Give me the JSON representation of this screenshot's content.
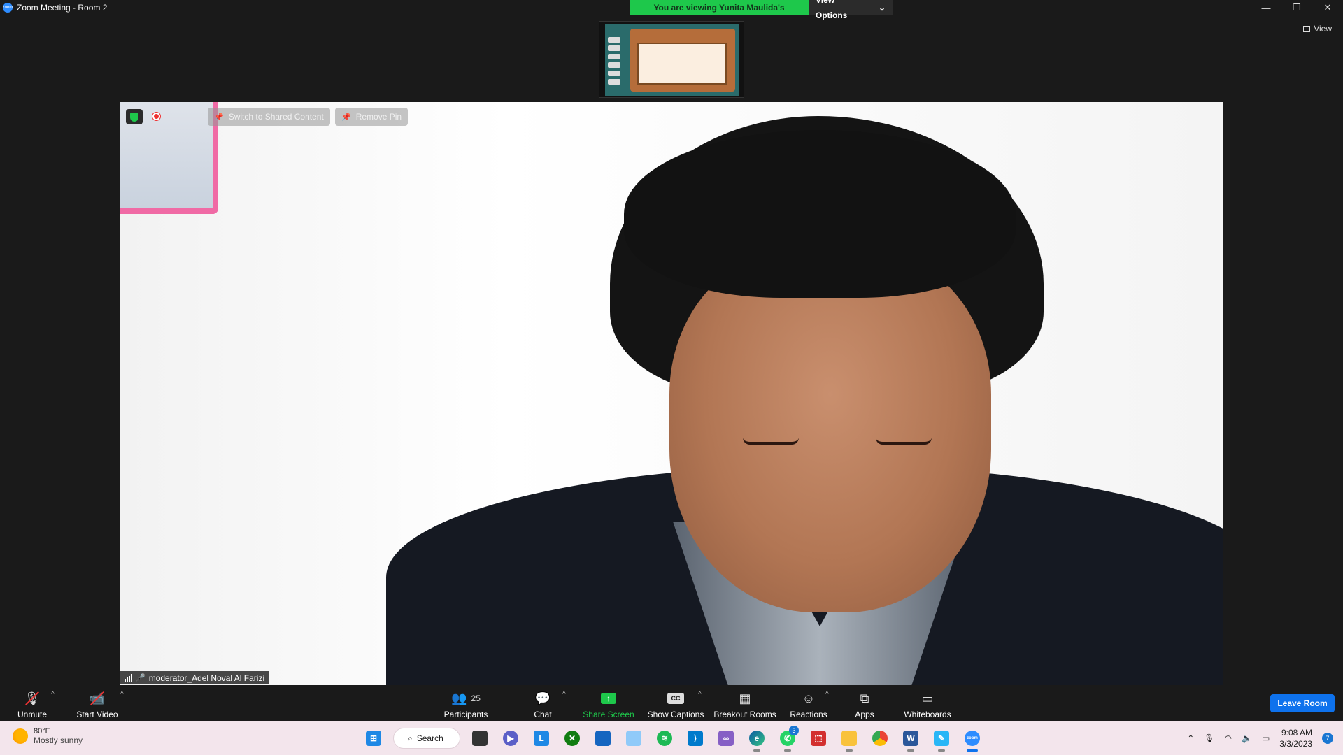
{
  "window": {
    "title": "Zoom Meeting - Room 2",
    "controls": {
      "minimize": "—",
      "restore": "❐",
      "close": "✕"
    }
  },
  "banner": {
    "viewing_text": "You are viewing Yunita Maulida's screen",
    "view_options_label": "View Options",
    "caret": "⌄"
  },
  "view_button": {
    "label": "View"
  },
  "video": {
    "switch_label": "Switch to Shared Content",
    "remove_pin_label": "Remove Pin",
    "participant_name": "moderator_Adel Noval Al Farizi"
  },
  "toolbar": {
    "unmute": "Unmute",
    "start_video": "Start Video",
    "participants": "Participants",
    "participants_count": "25",
    "chat": "Chat",
    "share_screen": "Share Screen",
    "show_captions": "Show Captions",
    "breakout_rooms": "Breakout Rooms",
    "reactions": "Reactions",
    "apps": "Apps",
    "whiteboards": "Whiteboards",
    "leave": "Leave Room",
    "caret": "^"
  },
  "colors": {
    "zoom_blue": "#0e72ed",
    "share_green": "#1ec84b",
    "dark_bg": "#1a1a1a",
    "taskbar_bg": "#f3e5ec"
  },
  "taskbar": {
    "weather_temp": "80°F",
    "weather_desc": "Mostly sunny",
    "search_label": "Search",
    "whatsapp_badge": "3",
    "time": "9:08 AM",
    "date": "3/3/2023",
    "notification_count": "7",
    "apps": [
      "windows-start",
      "search",
      "task-view",
      "teams-meet",
      "l-app",
      "xbox",
      "store",
      "photos",
      "spotify",
      "vscode",
      "visual-studio",
      "edge",
      "whatsapp",
      "pdf-app",
      "file-explorer",
      "chrome",
      "word",
      "paint",
      "zoom"
    ]
  }
}
